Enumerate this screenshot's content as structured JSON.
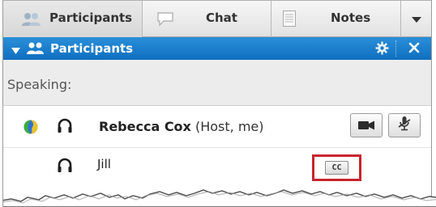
{
  "tabs": [
    {
      "label": "Participants",
      "icon": "participants-icon"
    },
    {
      "label": "Chat",
      "icon": "chat-bubble-icon"
    },
    {
      "label": "Notes",
      "icon": "notes-icon"
    }
  ],
  "tab_menu_icon": "chevron-down-icon",
  "panel": {
    "title": "Participants",
    "collapse_icon": "triangle-down-icon",
    "settings_icon": "gear-icon",
    "close_icon": "close-icon"
  },
  "speaking_label": "Speaking:",
  "participants": [
    {
      "name": "Rebecca Cox",
      "role": "(Host, me)",
      "status_icon": "globe-icon",
      "audio_icon": "headset-icon",
      "video_button_icon": "video-camera-icon",
      "mic_button_icon": "microphone-muted-icon"
    },
    {
      "name": "Jill",
      "audio_icon": "headset-icon",
      "cc_label": "CC",
      "cc_highlight_color": "#c8252c"
    }
  ],
  "colors": {
    "header_blue": "#0f6fbf",
    "speaking_bg": "#ececec",
    "highlight": "#c8252c"
  }
}
